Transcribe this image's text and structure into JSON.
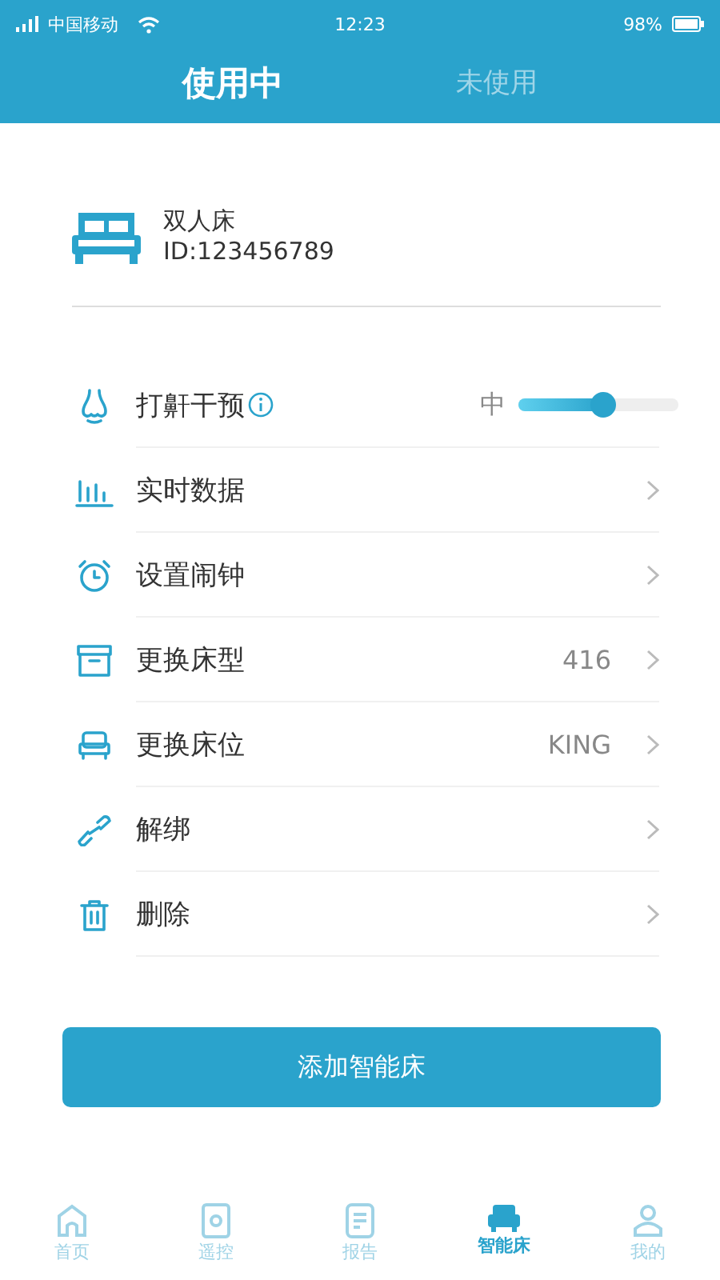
{
  "status_bar": {
    "carrier": "中国移动",
    "time": "12:23",
    "battery": "98%"
  },
  "tabs": [
    {
      "label": "使用中",
      "selected": true
    },
    {
      "label": "未使用",
      "selected": false
    }
  ],
  "device": {
    "name": "双人床",
    "id": "ID:123456789"
  },
  "settings": [
    {
      "kind": "slider",
      "label": "打鼾干预",
      "value": "中",
      "level": 0.53
    },
    {
      "kind": "link",
      "label": "实时数据"
    },
    {
      "kind": "link",
      "label": "设置闹钟"
    },
    {
      "kind": "link",
      "label": "更换床型",
      "value": "416"
    },
    {
      "kind": "link",
      "label": "更换床位",
      "value": "KING"
    },
    {
      "kind": "link",
      "label": "解绑"
    },
    {
      "kind": "link",
      "label": "删除"
    }
  ],
  "add_button": "添加智能床",
  "nav": [
    {
      "label": "首页",
      "selected": false
    },
    {
      "label": "遥控",
      "selected": false
    },
    {
      "label": "报告",
      "selected": false
    },
    {
      "label": "智能床",
      "selected": true
    },
    {
      "label": "我的",
      "selected": false
    }
  ]
}
